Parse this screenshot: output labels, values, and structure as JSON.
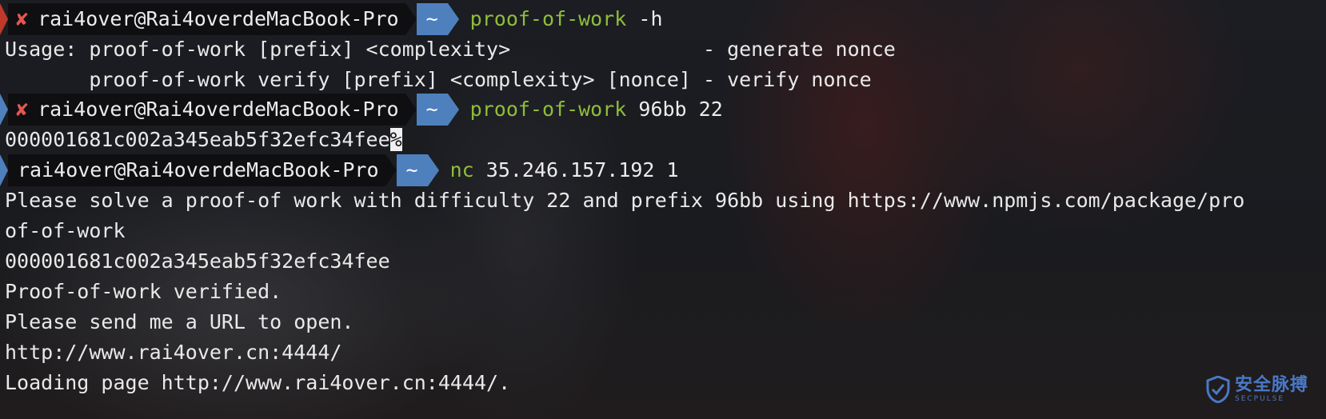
{
  "prompts": [
    {
      "status_mark": "✘",
      "user_host": "rai4over@Rai4overdeMacBook-Pro",
      "dir": "~",
      "cmd": "proof-of-work",
      "args": " -h"
    },
    {
      "status_mark": "✘",
      "user_host": "rai4over@Rai4overdeMacBook-Pro",
      "dir": "~",
      "cmd": "proof-of-work",
      "args": " 96bb 22"
    },
    {
      "status_mark": "",
      "user_host": "rai4over@Rai4overdeMacBook-Pro",
      "dir": "~",
      "cmd": "nc",
      "args": " 35.246.157.192 1"
    }
  ],
  "output": {
    "usage_1": "Usage: proof-of-work [prefix] <complexity>                - generate nonce",
    "usage_2": "       proof-of-work verify [prefix] <complexity> [nonce] - verify nonce",
    "nonce_line": "000001681c002a345eab5f32efc34fee",
    "nonce_cursor": "%",
    "nc_1": "Please solve a proof-of work with difficulty 22 and prefix 96bb using https://www.npmjs.com/package/pro",
    "nc_2": "of-of-work",
    "nc_3": "000001681c002a345eab5f32efc34fee",
    "nc_4": "Proof-of-work verified.",
    "nc_5": "Please send me a URL to open.",
    "nc_6": "http://www.rai4over.cn:4444/",
    "nc_7": "Loading page http://www.rai4over.cn:4444/."
  },
  "watermark": {
    "cn": "安全脉搏",
    "en": "SECPULSE"
  },
  "colors": {
    "dir_segment": "#4e80be",
    "command": "#8fbd3a",
    "error_mark": "#e5574f",
    "watermark": "#4a78c8"
  }
}
